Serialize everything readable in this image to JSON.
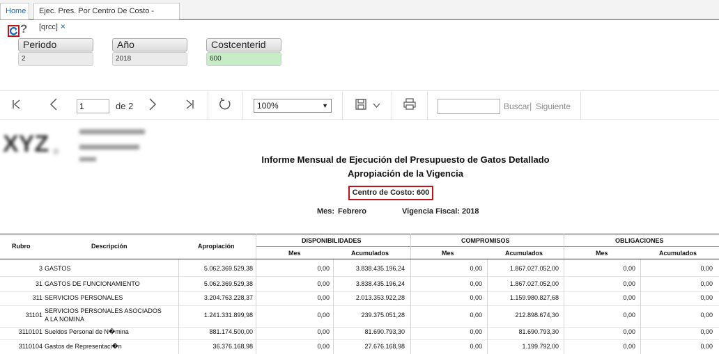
{
  "tabs": {
    "home": "Home",
    "active": "Ejec. Pres. Por Centro De Costo -[qrcc]",
    "close": "×"
  },
  "params": {
    "periodo_label": "Periodo",
    "periodo_value": "2",
    "anio_label": "Año",
    "anio_value": "2018",
    "cc_label": "Costcenterid",
    "cc_value": "600"
  },
  "toolbar": {
    "page": "1",
    "page_of": "de 2",
    "zoom": "100%",
    "buscar": "Buscar",
    "pipe": "|",
    "siguiente": "Siguiente"
  },
  "report": {
    "title1": "Informe Mensual de Ejecución del Presupuesto de Gatos Detallado",
    "title2": "Apropiación de la Vigencia",
    "centro": "Centro de Costo: 600",
    "mes_label": "Mes:",
    "mes_value": "Febrero",
    "vigencia": "Vigencia Fiscal: 2018"
  },
  "table": {
    "headers": {
      "rubro": "Rubro",
      "descripcion": "Descripción",
      "apropiacion": "Apropiación",
      "disponibilidades": "DISPONIBILIDADES",
      "compromisos": "COMPROMISOS",
      "obligaciones": "OBLIGACIONES",
      "mes": "Mes",
      "acumulados": "Acumulados"
    },
    "rows": [
      {
        "rubro": "3",
        "desc": "GASTOS",
        "desc2": "",
        "apro": "5.062.369.529,38",
        "dmes": "0,00",
        "dacu": "3.838.435.196,24",
        "cmes": "0,00",
        "cacu": "1.867.027.052,00",
        "omes": "0,00",
        "oacu": "0,00"
      },
      {
        "rubro": "31",
        "desc": "GASTOS DE FUNCIONAMIENTO",
        "desc2": "",
        "apro": "5.062.369.529,38",
        "dmes": "0,00",
        "dacu": "3.838.435.196,24",
        "cmes": "0,00",
        "cacu": "1.867.027.052,00",
        "omes": "0,00",
        "oacu": "0,00"
      },
      {
        "rubro": "311",
        "desc": "SERVICIOS PERSONALES",
        "desc2": "",
        "apro": "3.204.763.228,37",
        "dmes": "0,00",
        "dacu": "2.013.353.922,28",
        "cmes": "0,00",
        "cacu": "1.159.980.827,68",
        "omes": "0,00",
        "oacu": "0,00"
      },
      {
        "rubro": "31101",
        "desc": "SERVICIOS PERSONALES ASOCIADOS",
        "desc2": "A LA NOMINA",
        "apro": "1.241.331.899,98",
        "dmes": "0,00",
        "dacu": "239.375.051,28",
        "cmes": "0,00",
        "cacu": "212.898.674,30",
        "omes": "0,00",
        "oacu": "0,00"
      },
      {
        "rubro": "3110101",
        "desc": "Sueldos Personal de N�mina",
        "desc2": "",
        "apro": "881.174.500,00",
        "dmes": "0,00",
        "dacu": "81.690.793,30",
        "cmes": "0,00",
        "cacu": "81.690.793,30",
        "omes": "0,00",
        "oacu": "0,00"
      },
      {
        "rubro": "3110104",
        "desc": "Gastos de Representaci�n",
        "desc2": "",
        "apro": "36.376.168,98",
        "dmes": "0,00",
        "dacu": "27.676.168,98",
        "cmes": "0,00",
        "cacu": "1.199.792,00",
        "omes": "0,00",
        "oacu": "0,00"
      }
    ]
  },
  "colors": {
    "accent": "#1a66b3",
    "highlight_border": "#c0141b",
    "param_highlight": "#c6edc6"
  },
  "icons": [
    "refresh-icon",
    "help-icon",
    "first-page-icon",
    "prev-page-icon",
    "next-page-icon",
    "last-page-icon",
    "reload-icon",
    "save-icon",
    "chevron-down-icon",
    "print-icon"
  ]
}
